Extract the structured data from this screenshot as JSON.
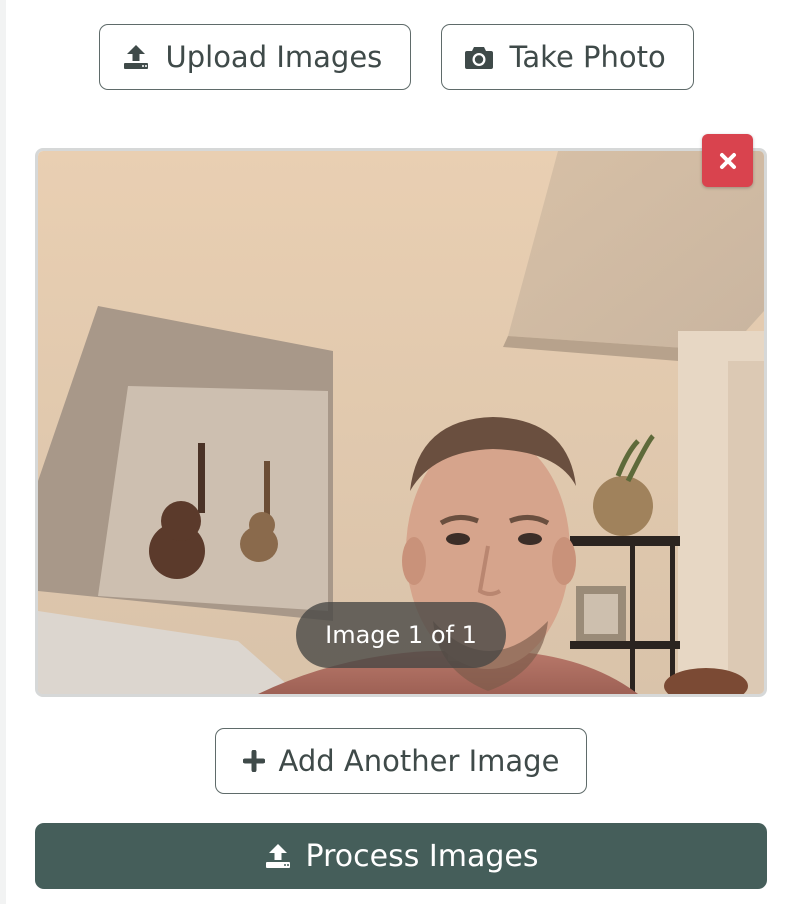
{
  "toolbar": {
    "upload_label": "Upload Images",
    "upload_icon": "upload-icon",
    "photo_label": "Take Photo",
    "photo_icon": "camera-icon"
  },
  "preview": {
    "counter_text": "Image 1 of 1",
    "remove_icon": "close-icon",
    "remove_color": "#d9434e"
  },
  "actions": {
    "add_label": "Add Another Image",
    "add_icon": "plus-icon",
    "process_label": "Process Images",
    "process_icon": "upload-icon"
  },
  "colors": {
    "primary": "#455e5a",
    "outline": "#5f6b6a",
    "danger": "#d9434e"
  }
}
